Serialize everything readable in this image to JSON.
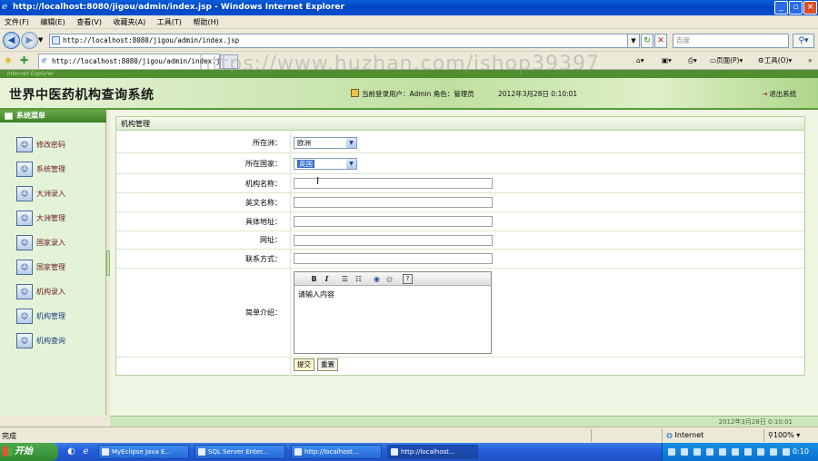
{
  "window": {
    "title": "http://localhost:8080/jigou/admin/index.jsp - Windows Internet Explorer"
  },
  "menu": [
    "文件(F)",
    "编辑(E)",
    "查看(V)",
    "收藏夹(A)",
    "工具(T)",
    "帮助(H)"
  ],
  "address": {
    "url": "http://localhost:8080/jigou/admin/index.jsp",
    "search_placeholder": "百度"
  },
  "tab": {
    "title": "http://localhost:8080/jigou/admin/index.jsp"
  },
  "toolbar_right": {
    "page": "页面(P)",
    "tools": "工具(O)"
  },
  "watermark": "https://www.huzhan.com/ishop39397",
  "app": {
    "strip_text": "Internet Explorer",
    "title": "世界中医药机构查询系统",
    "user_label": "当前登录用户：Admin 角色：管理员",
    "datetime": "2012年3月28日  0:10:01",
    "logout": "退出系统"
  },
  "sidebar": {
    "title": "系统菜单",
    "items": [
      {
        "label": "修改密码"
      },
      {
        "label": "系统管理"
      },
      {
        "label": "大洲录入"
      },
      {
        "label": "大洲管理"
      },
      {
        "label": "国家录入"
      },
      {
        "label": "国家管理"
      },
      {
        "label": "机构录入"
      },
      {
        "label": "机构管理"
      },
      {
        "label": "机构查询"
      }
    ]
  },
  "form": {
    "panel_title": "机构管理",
    "continent_label": "所在洲：",
    "continent_value": "欧洲",
    "country_label": "所在国家：",
    "country_value": "英国",
    "name_label": "机构名称：",
    "english_name_label": "英文名称：",
    "address_label": "具体地址：",
    "website_label": "网址：",
    "contact_label": "联系方式：",
    "intro_label": "简单介绍：",
    "intro_placeholder": "请输入内容",
    "submit": "提交",
    "reset": "重置"
  },
  "footer": {
    "date": "2012年3月28日  0:10:01"
  },
  "statusbar": {
    "left": "完成",
    "zone": "Internet",
    "zoom": "100%"
  },
  "taskbar": {
    "start": "开始",
    "tasks": [
      {
        "label": "MyEclipse Java E..."
      },
      {
        "label": "SQL Server Enter..."
      },
      {
        "label": "http://localhost..."
      },
      {
        "label": "http://localhost..."
      }
    ],
    "clock": "0:10"
  }
}
